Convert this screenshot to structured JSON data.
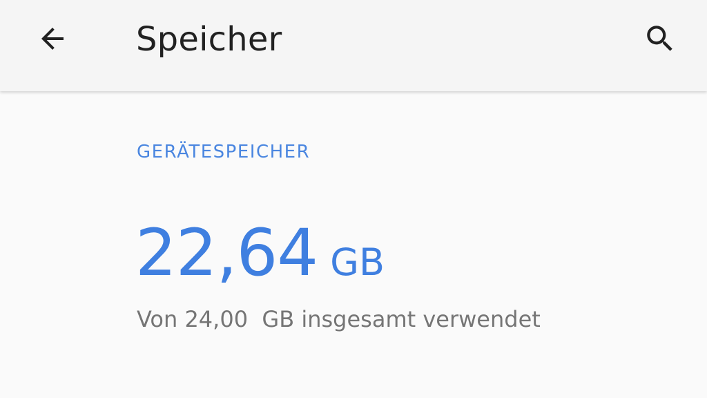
{
  "app_bar": {
    "title": "Speicher",
    "back_icon": "arrow-back-icon",
    "search_icon": "search-icon"
  },
  "device_storage": {
    "section_title": "GERÄTESPEICHER",
    "used_value": "22,64",
    "used_unit": "GB",
    "summary": "Von 24,00  GB insgesamt verwendet"
  },
  "colors": {
    "accent": "#4a86e0",
    "app_bar_bg": "#f5f5f5",
    "background": "#fafafa",
    "title_text": "#212121",
    "secondary_text": "#757575"
  }
}
